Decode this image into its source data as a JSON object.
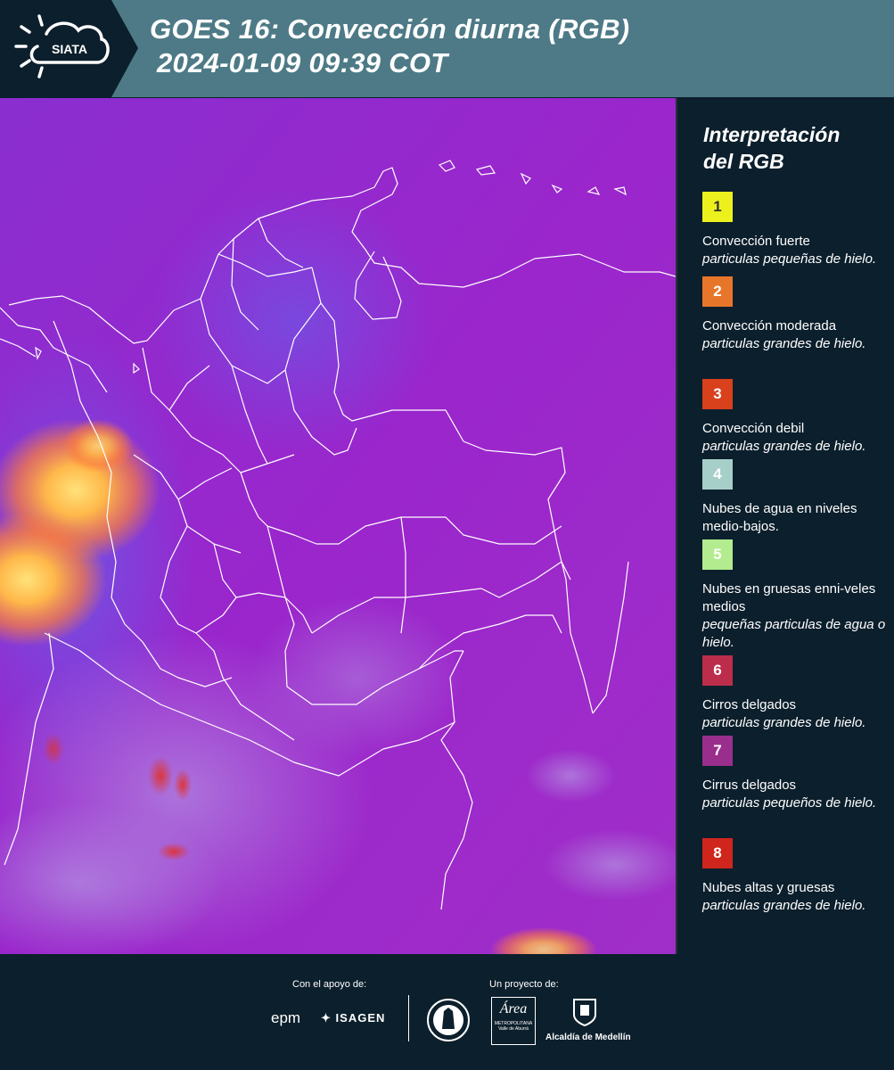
{
  "header": {
    "logo_text": "SIATA",
    "title_line1": "GOES 16: Convección diurna (RGB)",
    "title_line2": "2024-01-09 09:39 COT"
  },
  "legend": {
    "title_line1": "Interpretación",
    "title_line2": "del RGB",
    "items": [
      {
        "num": "1",
        "color": "#ecf11e",
        "text_color": "#333333",
        "name": "Convección fuerte",
        "desc": "particulas pequeñas de hielo."
      },
      {
        "num": "2",
        "color": "#e8762a",
        "text_color": "#ffffff",
        "name": "Convección moderada",
        "desc": "particulas grandes de hielo."
      },
      {
        "num": "3",
        "color": "#d9401c",
        "text_color": "#ffffff",
        "name": "Convección debil",
        "desc": "particulas grandes de hielo."
      },
      {
        "num": "4",
        "color": "#a6cfc9",
        "text_color": "#ffffff",
        "name": "Nubes de agua en niveles medio-bajos.",
        "desc": ""
      },
      {
        "num": "5",
        "color": "#b2ec8e",
        "text_color": "#ffffff",
        "name": "Nubes en gruesas enni-veles medios",
        "desc": "pequeñas particulas de agua o hielo."
      },
      {
        "num": "6",
        "color": "#bb2d4a",
        "text_color": "#ffffff",
        "name": "Cirros delgados",
        "desc": "particulas grandes de hielo."
      },
      {
        "num": "7",
        "color": "#992e8c",
        "text_color": "#ffffff",
        "name": "Cirrus delgados",
        "desc": "particulas pequeños de hielo."
      },
      {
        "num": "8",
        "color": "#d0251c",
        "text_color": "#ffffff",
        "name": "Nubes altas y gruesas",
        "desc": "particulas grandes de hielo."
      }
    ]
  },
  "footer": {
    "support_label": "Con el apoyo de:",
    "project_label": "Un proyecto de:",
    "sponsors": [
      "epm",
      "ISAGEN"
    ],
    "area_logo": "Área",
    "area_sub1": "METROPOLITANA",
    "area_sub2": "Valle de Aburrá",
    "alcaldia": "Alcaldía de Medellín"
  },
  "colors": {
    "background": "#0c1f2c",
    "header": "#4d7a86",
    "map_base": "#9a28c8"
  }
}
